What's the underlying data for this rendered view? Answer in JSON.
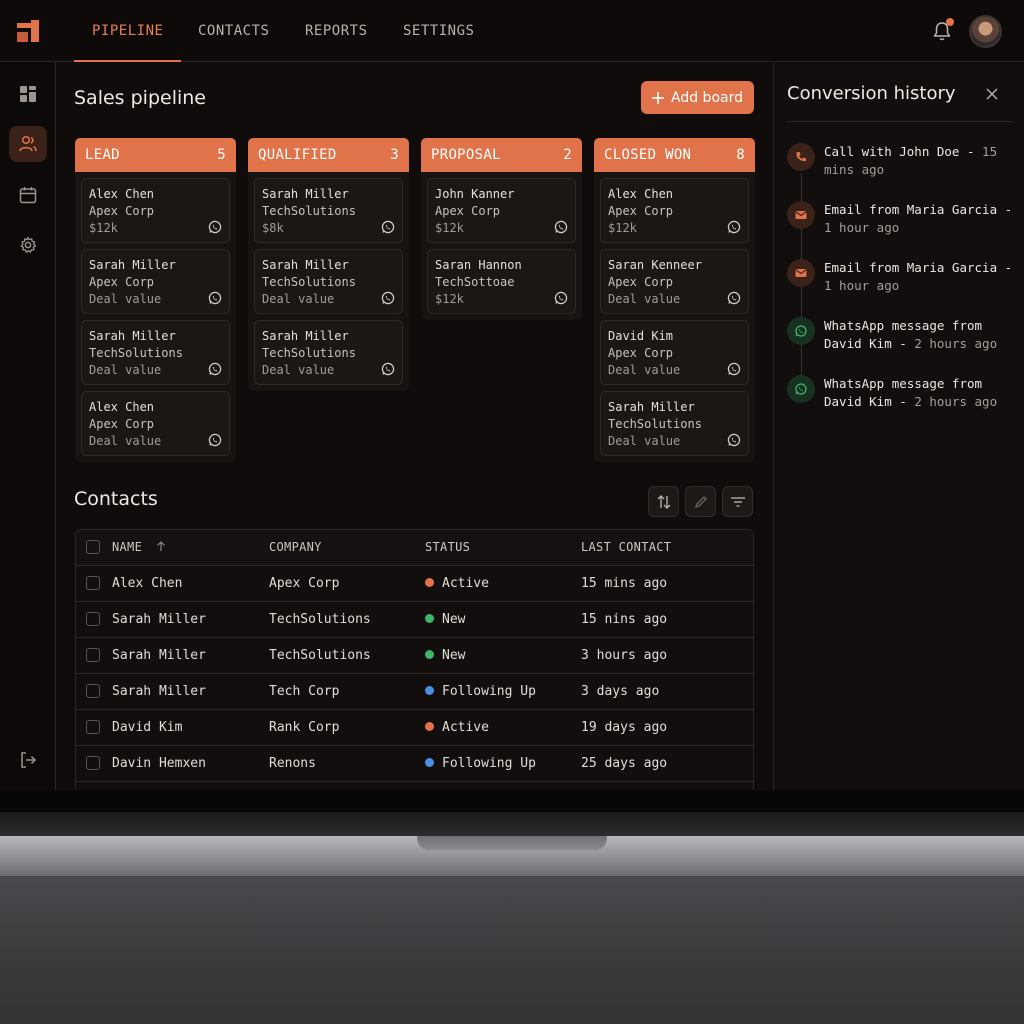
{
  "nav": {
    "tabs": [
      "PIPELINE",
      "CONTACTS",
      "REPORTS",
      "SETTINGS"
    ],
    "active": "PIPELINE"
  },
  "colors": {
    "accent": "#e0734a",
    "active_status": "#e0734a",
    "new_status": "#3fb56a",
    "following_status": "#4b8fe0"
  },
  "pipeline": {
    "title": "Sales pipeline",
    "add_board_label": "Add board",
    "columns": [
      {
        "name": "LEAD",
        "count": "5",
        "cards": [
          {
            "name": "Alex Chen",
            "company": "Apex Corp",
            "value": "$12k"
          },
          {
            "name": "Sarah Miller",
            "company": "Apex Corp",
            "value": "Deal value"
          },
          {
            "name": "Sarah Miller",
            "company": "TechSolutions",
            "value": "Deal value"
          },
          {
            "name": "Alex Chen",
            "company": "Apex Corp",
            "value": "Deal value"
          }
        ]
      },
      {
        "name": "QUALIFIED",
        "count": "3",
        "cards": [
          {
            "name": "Sarah Miller",
            "company": "TechSolutions",
            "value": "$8k"
          },
          {
            "name": "Sarah Miller",
            "company": "TechSolutions",
            "value": "Deal value"
          },
          {
            "name": "Sarah Miller",
            "company": "TechSolutions",
            "value": "Deal value"
          }
        ]
      },
      {
        "name": "PROPOSAL",
        "count": "2",
        "cards": [
          {
            "name": "John Kanner",
            "company": "Apex Corp",
            "value": "$12k"
          },
          {
            "name": "Saran Hannon",
            "company": "TechSottoae",
            "value": "$12k"
          }
        ]
      },
      {
        "name": "CLOSED WON",
        "count": "8",
        "cards": [
          {
            "name": "Alex Chen",
            "company": "Apex Corp",
            "value": "$12k"
          },
          {
            "name": "Saran Kenneer",
            "company": "Apex Corp",
            "value": "Deal value"
          },
          {
            "name": "David Kim",
            "company": "Apex Corp",
            "value": "Deal value"
          },
          {
            "name": "Sarah Miller",
            "company": "TechSolutions",
            "value": "Deal value"
          }
        ]
      }
    ]
  },
  "contacts": {
    "title": "Contacts",
    "headers": {
      "name": "NAME",
      "company": "COMPANY",
      "status": "STATUS",
      "last_contact": "LAST CONTACT"
    },
    "rows": [
      {
        "name": "Alex Chen",
        "company": "Apex Corp",
        "status": "Active",
        "status_color": "#e0734a",
        "last": "15 mins ago"
      },
      {
        "name": "Sarah Miller",
        "company": "TechSolutions",
        "status": "New",
        "status_color": "#3fb56a",
        "last": "15 nins ago"
      },
      {
        "name": "Sarah Miller",
        "company": "TechSolutions",
        "status": "New",
        "status_color": "#3fb56a",
        "last": "3 hours ago"
      },
      {
        "name": "Sarah Miller",
        "company": "Tech Corp",
        "status": "Following Up",
        "status_color": "#4b8fe0",
        "last": "3 days ago"
      },
      {
        "name": "David Kim",
        "company": "Rank Corp",
        "status": "Active",
        "status_color": "#e0734a",
        "last": "19 days ago"
      },
      {
        "name": "Davin Hemxen",
        "company": "Renons",
        "status": "Following Up",
        "status_color": "#4b8fe0",
        "last": "25 days ago"
      }
    ]
  },
  "history": {
    "title": "Conversion history",
    "items": [
      {
        "type": "call",
        "text": "Call with John Doe -",
        "time": "15 mins ago"
      },
      {
        "type": "email",
        "text": "Email from Maria Garcia -",
        "time": "1 hour ago"
      },
      {
        "type": "email",
        "text": "Email from Maria Garcia -",
        "time": "1 hour ago"
      },
      {
        "type": "whatsapp",
        "text": "WhatsApp message from David Kim -",
        "time": "2 hours ago"
      },
      {
        "type": "whatsapp",
        "text": "WhatsApp message from David Kim -",
        "time": "2 hours ago"
      }
    ]
  }
}
